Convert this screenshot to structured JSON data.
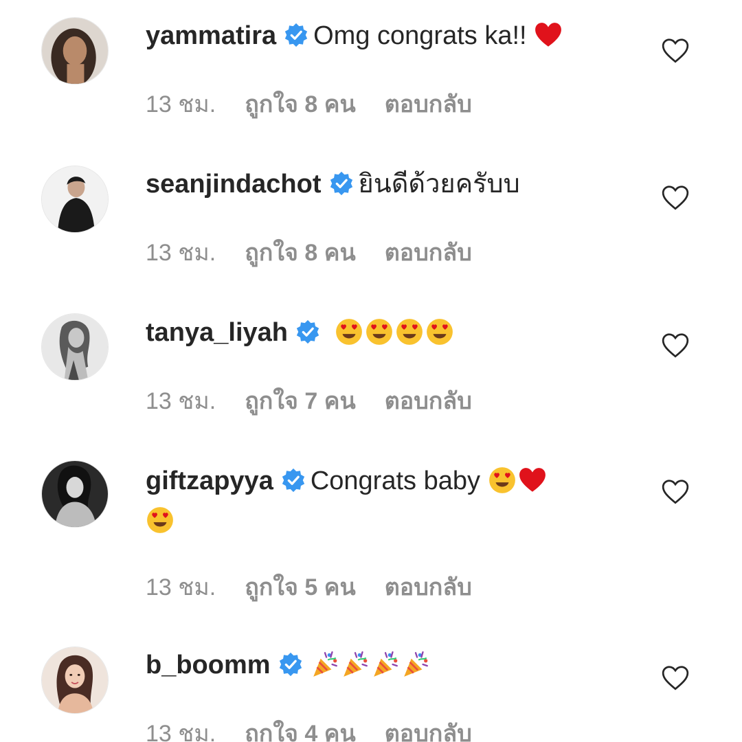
{
  "comments": [
    {
      "username": "yammatira",
      "text": "Omg congrats ka!! ",
      "emojis": [
        "red-heart"
      ],
      "time": "13 ชม.",
      "likes": "ถูกใจ 8 คน",
      "reply": "ตอบกลับ"
    },
    {
      "username": "seanjindachot",
      "text": "ยินดีด้วยครับบ",
      "emojis": [],
      "time": "13 ชม.",
      "likes": "ถูกใจ 8 คน",
      "reply": "ตอบกลับ"
    },
    {
      "username": "tanya_liyah",
      "text": "",
      "emojis": [
        "heart-eyes",
        "heart-eyes",
        "heart-eyes",
        "heart-eyes"
      ],
      "time": "13 ชม.",
      "likes": "ถูกใจ 7 คน",
      "reply": "ตอบกลับ"
    },
    {
      "username": "giftzapyya",
      "text": "Congrats baby ",
      "emojis": [
        "heart-eyes",
        "red-heart",
        "heart-eyes"
      ],
      "time": "13 ชม.",
      "likes": "ถูกใจ 5 คน",
      "reply": "ตอบกลับ"
    },
    {
      "username": "b_boomm",
      "text": "",
      "emojis": [
        "party-popper",
        "party-popper",
        "party-popper",
        "party-popper"
      ],
      "time": "13 ชม.",
      "likes": "ถูกใจ 4 คน",
      "reply": "ตอบกลับ"
    }
  ],
  "colors": {
    "verified": "#3897f0",
    "meta": "#8e8e8e",
    "text": "#262626",
    "heart": "#ed4956"
  }
}
